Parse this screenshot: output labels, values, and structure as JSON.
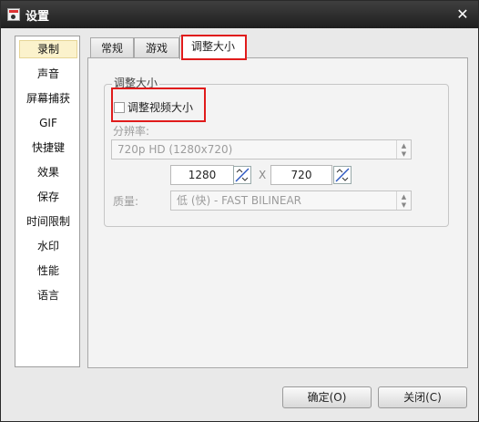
{
  "window": {
    "title": "设置",
    "close_glyph": "✕"
  },
  "sidebar": {
    "items": [
      {
        "label": "录制",
        "active": true
      },
      {
        "label": "声音"
      },
      {
        "label": "屏幕捕获"
      },
      {
        "label": "GIF"
      },
      {
        "label": "快捷键"
      },
      {
        "label": "效果"
      },
      {
        "label": "保存"
      },
      {
        "label": "时间限制"
      },
      {
        "label": "水印"
      },
      {
        "label": "性能"
      },
      {
        "label": "语言"
      }
    ]
  },
  "tabs": [
    {
      "label": "常规"
    },
    {
      "label": "游戏"
    },
    {
      "label": "调整大小",
      "active": true
    }
  ],
  "resize": {
    "group_title": "调整大小",
    "checkbox_label": "调整视频大小",
    "checkbox_checked": false,
    "resolution_label": "分辨率:",
    "resolution_value": "720p HD (1280x720)",
    "width": "1280",
    "height": "720",
    "times_sign": "X",
    "quality_label": "质量:",
    "quality_value": "低 (快) - FAST BILINEAR"
  },
  "buttons": {
    "ok": "确定(O)",
    "close": "关闭(C)"
  },
  "colors": {
    "highlight": "#e01b1b",
    "active_sidebar": "#fbf2cc"
  }
}
